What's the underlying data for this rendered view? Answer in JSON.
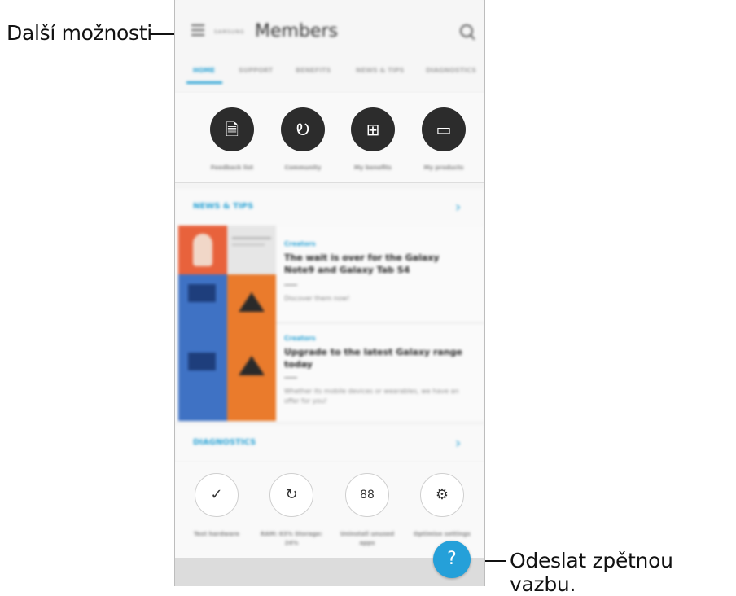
{
  "callouts": {
    "more_options": "Další možnosti",
    "send_feedback": "Odeslat zpětnou vazbu."
  },
  "app": {
    "brand": "SAMSUNG",
    "title": "Members"
  },
  "tabs": [
    {
      "label": "HOME",
      "active": true
    },
    {
      "label": "SUPPORT"
    },
    {
      "label": "BENEFITS"
    },
    {
      "label": "NEWS & TIPS"
    },
    {
      "label": "DIAGNOSTICS"
    }
  ],
  "shortcuts": [
    {
      "label": "Feedback list",
      "icon": "document-icon",
      "glyph": "🗎"
    },
    {
      "label": "Community",
      "icon": "community-icon",
      "glyph": "Ꭷ"
    },
    {
      "label": "My benefits",
      "icon": "gift-icon",
      "glyph": "⊞"
    },
    {
      "label": "My products",
      "icon": "devices-icon",
      "glyph": "▭"
    }
  ],
  "news": {
    "title": "NEWS & TIPS",
    "articles": [
      {
        "category": "Creators",
        "title": "The wait is over for the Galaxy Note9 and Galaxy Tab S4",
        "desc": "Discover them now!"
      },
      {
        "category": "Creators",
        "title": "Upgrade to the latest Galaxy range today",
        "desc": "Whether its mobile devices or wearables, we have an offer for you!"
      }
    ]
  },
  "diagnostics": {
    "title": "DIAGNOSTICS",
    "items": [
      {
        "label": "Test hardware",
        "icon": "check-icon",
        "glyph": "✓"
      },
      {
        "label": "RAM: 63% Storage: 24%",
        "icon": "refresh-icon",
        "glyph": "↻"
      },
      {
        "label": "Uninstall unused apps",
        "icon": "apps-icon",
        "glyph": "88"
      },
      {
        "label": "Optimise settings",
        "icon": "gear-icon",
        "glyph": "⚙"
      }
    ]
  },
  "fab": {
    "glyph": "?"
  },
  "colors": {
    "accent": "#2aa3d5",
    "fab": "#25a0d9",
    "dark_circle": "#2c2c2c"
  }
}
